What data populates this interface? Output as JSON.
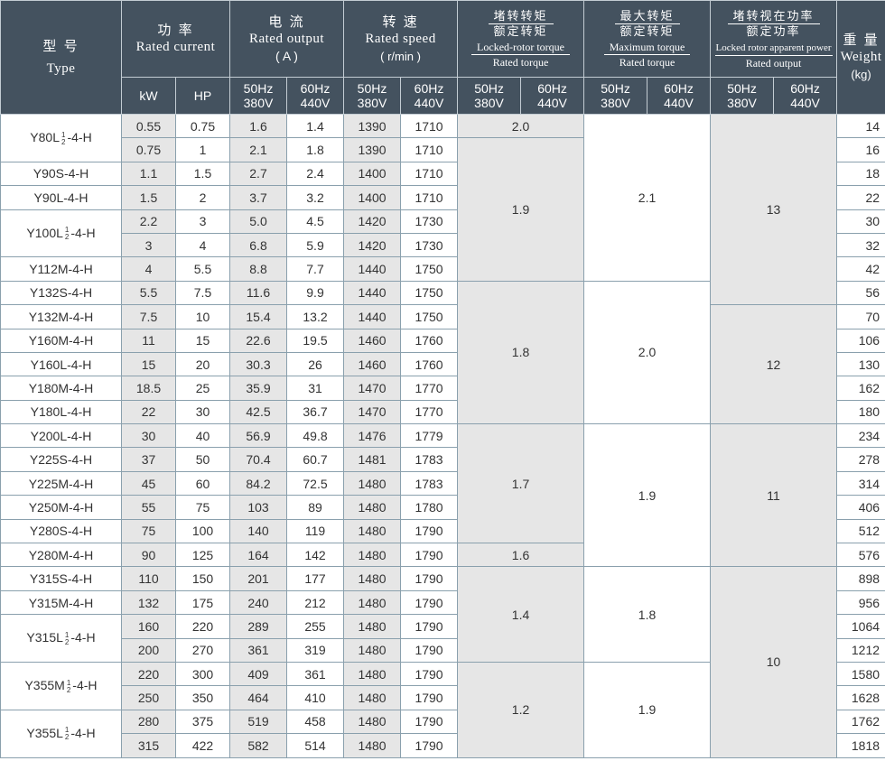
{
  "header": {
    "type": {
      "cn": "型 号",
      "en": "Type"
    },
    "power": {
      "cn": "功 率",
      "en": "Rated current",
      "unit1": "kW",
      "unit2": "HP"
    },
    "current": {
      "cn": "电 流",
      "en": "Rated output",
      "unit": "( A )"
    },
    "speed": {
      "cn": "转 速",
      "en": "Rated speed",
      "unit": "( r/min )"
    },
    "locked_torque": {
      "cn": "堵转转矩",
      "cn2": "额定转矩",
      "en": "Locked-rotor torque",
      "en2": "Rated torque"
    },
    "max_torque": {
      "cn": "最大转矩",
      "cn2": "额定转矩",
      "en": "Maximum torque",
      "en2": "Rated torque"
    },
    "apparent_power": {
      "cn": "堵转视在功率",
      "cn2": "额定功率",
      "en": "Locked rotor apparent power",
      "en2": "Rated output"
    },
    "weight": {
      "cn": "重 量",
      "en": "Weight",
      "unit": "(kg)"
    },
    "freq50": {
      "hz": "50Hz",
      "v": "380V"
    },
    "freq60": {
      "hz": "60Hz",
      "v": "440V"
    }
  },
  "rows": [
    {
      "kw": "0.55",
      "hp": "0.75",
      "a50": "1.6",
      "a60": "1.4",
      "r50": "1390",
      "r60": "1710",
      "wt": "14"
    },
    {
      "kw": "0.75",
      "hp": "1",
      "a50": "2.1",
      "a60": "1.8",
      "r50": "1390",
      "r60": "1710",
      "wt": "16"
    },
    {
      "kw": "1.1",
      "hp": "1.5",
      "a50": "2.7",
      "a60": "2.4",
      "r50": "1400",
      "r60": "1710",
      "wt": "18"
    },
    {
      "kw": "1.5",
      "hp": "2",
      "a50": "3.7",
      "a60": "3.2",
      "r50": "1400",
      "r60": "1710",
      "wt": "22"
    },
    {
      "kw": "2.2",
      "hp": "3",
      "a50": "5.0",
      "a60": "4.5",
      "r50": "1420",
      "r60": "1730",
      "wt": "30"
    },
    {
      "kw": "3",
      "hp": "4",
      "a50": "6.8",
      "a60": "5.9",
      "r50": "1420",
      "r60": "1730",
      "wt": "32"
    },
    {
      "kw": "4",
      "hp": "5.5",
      "a50": "8.8",
      "a60": "7.7",
      "r50": "1440",
      "r60": "1750",
      "wt": "42"
    },
    {
      "kw": "5.5",
      "hp": "7.5",
      "a50": "11.6",
      "a60": "9.9",
      "r50": "1440",
      "r60": "1750",
      "wt": "56"
    },
    {
      "kw": "7.5",
      "hp": "10",
      "a50": "15.4",
      "a60": "13.2",
      "r50": "1440",
      "r60": "1750",
      "wt": "70"
    },
    {
      "kw": "11",
      "hp": "15",
      "a50": "22.6",
      "a60": "19.5",
      "r50": "1460",
      "r60": "1760",
      "wt": "106"
    },
    {
      "kw": "15",
      "hp": "20",
      "a50": "30.3",
      "a60": "26",
      "r50": "1460",
      "r60": "1760",
      "wt": "130"
    },
    {
      "kw": "18.5",
      "hp": "25",
      "a50": "35.9",
      "a60": "31",
      "r50": "1470",
      "r60": "1770",
      "wt": "162"
    },
    {
      "kw": "22",
      "hp": "30",
      "a50": "42.5",
      "a60": "36.7",
      "r50": "1470",
      "r60": "1770",
      "wt": "180"
    },
    {
      "kw": "30",
      "hp": "40",
      "a50": "56.9",
      "a60": "49.8",
      "r50": "1476",
      "r60": "1779",
      "wt": "234"
    },
    {
      "kw": "37",
      "hp": "50",
      "a50": "70.4",
      "a60": "60.7",
      "r50": "1481",
      "r60": "1783",
      "wt": "278"
    },
    {
      "kw": "45",
      "hp": "60",
      "a50": "84.2",
      "a60": "72.5",
      "r50": "1480",
      "r60": "1783",
      "wt": "314"
    },
    {
      "kw": "55",
      "hp": "75",
      "a50": "103",
      "a60": "89",
      "r50": "1480",
      "r60": "1780",
      "wt": "406"
    },
    {
      "kw": "75",
      "hp": "100",
      "a50": "140",
      "a60": "119",
      "r50": "1480",
      "r60": "1790",
      "wt": "512"
    },
    {
      "kw": "90",
      "hp": "125",
      "a50": "164",
      "a60": "142",
      "r50": "1480",
      "r60": "1790",
      "wt": "576"
    },
    {
      "kw": "110",
      "hp": "150",
      "a50": "201",
      "a60": "177",
      "r50": "1480",
      "r60": "1790",
      "wt": "898"
    },
    {
      "kw": "132",
      "hp": "175",
      "a50": "240",
      "a60": "212",
      "r50": "1480",
      "r60": "1790",
      "wt": "956"
    },
    {
      "kw": "160",
      "hp": "220",
      "a50": "289",
      "a60": "255",
      "r50": "1480",
      "r60": "1790",
      "wt": "1064"
    },
    {
      "kw": "200",
      "hp": "270",
      "a50": "361",
      "a60": "319",
      "r50": "1480",
      "r60": "1790",
      "wt": "1212"
    },
    {
      "kw": "220",
      "hp": "300",
      "a50": "409",
      "a60": "361",
      "r50": "1480",
      "r60": "1790",
      "wt": "1580"
    },
    {
      "kw": "250",
      "hp": "350",
      "a50": "464",
      "a60": "410",
      "r50": "1480",
      "r60": "1790",
      "wt": "1628"
    },
    {
      "kw": "280",
      "hp": "375",
      "a50": "519",
      "a60": "458",
      "r50": "1480",
      "r60": "1790",
      "wt": "1762"
    },
    {
      "kw": "315",
      "hp": "422",
      "a50": "582",
      "a60": "514",
      "r50": "1480",
      "r60": "1790",
      "wt": "1818"
    }
  ],
  "types": [
    {
      "pre": "Y80L",
      "f1": "1",
      "f2": "2",
      "post": "-4-H",
      "span": 2
    },
    {
      "pre": "Y90S-4-H",
      "span": 1
    },
    {
      "pre": "Y90L-4-H",
      "span": 1
    },
    {
      "pre": "Y100L",
      "f1": "1",
      "f2": "2",
      "post": "-4-H",
      "span": 2
    },
    {
      "pre": "Y112M-4-H",
      "span": 1
    },
    {
      "pre": "Y132S-4-H",
      "span": 1
    },
    {
      "pre": "Y132M-4-H",
      "span": 1
    },
    {
      "pre": "Y160M-4-H",
      "span": 1
    },
    {
      "pre": "Y160L-4-H",
      "span": 1
    },
    {
      "pre": "Y180M-4-H",
      "span": 1
    },
    {
      "pre": "Y180L-4-H",
      "span": 1
    },
    {
      "pre": "Y200L-4-H",
      "span": 1
    },
    {
      "pre": "Y225S-4-H",
      "span": 1
    },
    {
      "pre": "Y225M-4-H",
      "span": 1
    },
    {
      "pre": "Y250M-4-H",
      "span": 1
    },
    {
      "pre": "Y280S-4-H",
      "span": 1
    },
    {
      "pre": "Y280M-4-H",
      "span": 1
    },
    {
      "pre": "Y315S-4-H",
      "span": 1
    },
    {
      "pre": "Y315M-4-H",
      "span": 1
    },
    {
      "pre": "Y315L",
      "f1": "1",
      "f2": "2",
      "post": "-4-H",
      "span": 2
    },
    {
      "pre": "Y355M",
      "f1": "1",
      "f2": "2",
      "post": "-4-H",
      "span": 2
    },
    {
      "pre": "Y355L",
      "f1": "1",
      "f2": "2",
      "post": "-4-H",
      "span": 2
    }
  ],
  "locked_torque": [
    {
      "value": "2.0",
      "span": 1,
      "shade": "g"
    },
    {
      "value": "1.9",
      "span": 6,
      "shade": "g"
    },
    {
      "value": "1.8",
      "span": 6,
      "shade": "g"
    },
    {
      "value": "1.7",
      "span": 5,
      "shade": "g"
    },
    {
      "value": "1.6",
      "span": 1,
      "shade": "g"
    },
    {
      "value": "1.4",
      "span": 4,
      "shade": "g"
    },
    {
      "value": "1.2",
      "span": 4,
      "shade": "g"
    }
  ],
  "max_torque": [
    {
      "value": "2.1",
      "span": 7,
      "shade": "w"
    },
    {
      "value": "2.0",
      "span": 6,
      "shade": "w"
    },
    {
      "value": "1.9",
      "span": 6,
      "shade": "w"
    },
    {
      "value": "1.8",
      "span": 4,
      "shade": "w"
    },
    {
      "value": "1.9",
      "span": 4,
      "shade": "w"
    }
  ],
  "apparent_power": [
    {
      "value": "13",
      "span": 8,
      "shade": "g"
    },
    {
      "value": "12",
      "span": 5,
      "shade": "g"
    },
    {
      "value": "11",
      "span": 6,
      "shade": "g"
    },
    {
      "value": "10",
      "span": 8,
      "shade": "g"
    }
  ]
}
